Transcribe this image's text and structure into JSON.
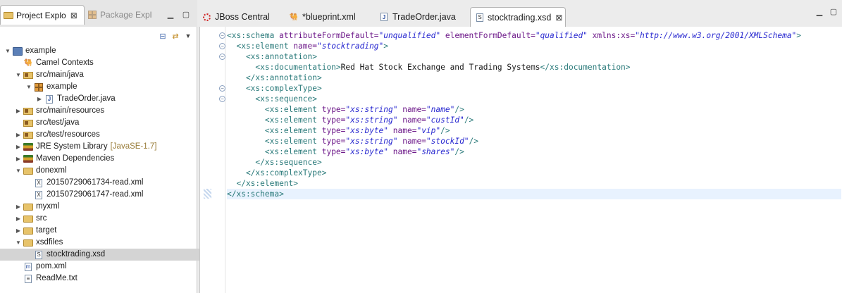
{
  "left_panel": {
    "tabs": [
      {
        "label": "Project Explo",
        "active": true,
        "close": "⊠"
      },
      {
        "label": "Package Expl",
        "active": false
      }
    ],
    "tree": [
      {
        "label": "example",
        "depth": 0,
        "arrow": "▼",
        "icon": "project-icon"
      },
      {
        "label": "Camel Contexts",
        "depth": 1,
        "arrow": "",
        "icon": "camel-icon"
      },
      {
        "label": "src/main/java",
        "depth": 1,
        "arrow": "▼",
        "icon": "source-folder-icon"
      },
      {
        "label": "example",
        "depth": 2,
        "arrow": "▼",
        "icon": "package-icon"
      },
      {
        "label": "TradeOrder.java",
        "depth": 3,
        "arrow": "▶",
        "icon": "java-file-icon"
      },
      {
        "label": "src/main/resources",
        "depth": 1,
        "arrow": "▶",
        "icon": "source-folder-icon"
      },
      {
        "label": "src/test/java",
        "depth": 1,
        "arrow": "",
        "icon": "source-folder-icon"
      },
      {
        "label": "src/test/resources",
        "depth": 1,
        "arrow": "▶",
        "icon": "source-folder-icon"
      },
      {
        "label": "JRE System Library",
        "suffix": "[JavaSE-1.7]",
        "depth": 1,
        "arrow": "▶",
        "icon": "library-icon"
      },
      {
        "label": "Maven Dependencies",
        "depth": 1,
        "arrow": "▶",
        "icon": "library-icon"
      },
      {
        "label": "donexml",
        "depth": 1,
        "arrow": "▼",
        "icon": "folder-icon"
      },
      {
        "label": "20150729061734-read.xml",
        "depth": 2,
        "arrow": "",
        "icon": "xml-file-icon"
      },
      {
        "label": "20150729061747-read.xml",
        "depth": 2,
        "arrow": "",
        "icon": "xml-file-icon"
      },
      {
        "label": "myxml",
        "depth": 1,
        "arrow": "▶",
        "icon": "folder-icon"
      },
      {
        "label": "src",
        "depth": 1,
        "arrow": "▶",
        "icon": "folder-icon"
      },
      {
        "label": "target",
        "depth": 1,
        "arrow": "▶",
        "icon": "folder-icon"
      },
      {
        "label": "xsdfiles",
        "depth": 1,
        "arrow": "▼",
        "icon": "folder-icon"
      },
      {
        "label": "stocktrading.xsd",
        "depth": 2,
        "arrow": "",
        "icon": "xsd-file-icon",
        "selected": true
      },
      {
        "label": "pom.xml",
        "depth": 1,
        "arrow": "",
        "icon": "maven-pom-icon"
      },
      {
        "label": "ReadMe.txt",
        "depth": 1,
        "arrow": "",
        "icon": "text-file-icon"
      }
    ]
  },
  "editor": {
    "tabs": [
      {
        "label": "JBoss Central",
        "icon": "jboss-icon"
      },
      {
        "label": "*blueprint.xml",
        "icon": "camel-icon"
      },
      {
        "label": "TradeOrder.java",
        "icon": "java-file-icon"
      },
      {
        "label": "stocktrading.xsd",
        "icon": "xsd-file-icon",
        "active": true,
        "close": "⊠"
      }
    ],
    "lines": [
      [
        [
          "tg",
          "<xs:schema "
        ],
        [
          "at",
          "attributeFormDefault="
        ],
        [
          "av",
          "\"unqualified\""
        ],
        [
          "at",
          " elementFormDefault="
        ],
        [
          "av",
          "\"qualified\""
        ],
        [
          "at",
          " xmlns:xs="
        ],
        [
          "av",
          "\"http://www.w3.org/2001/XMLSchema\""
        ],
        [
          "tg",
          ">"
        ]
      ],
      [
        [
          "tg",
          "  <xs:element "
        ],
        [
          "at",
          "name="
        ],
        [
          "av",
          "\"stocktrading\""
        ],
        [
          "tg",
          ">"
        ]
      ],
      [
        [
          "tg",
          "    <xs:annotation>"
        ]
      ],
      [
        [
          "tg",
          "      <xs:documentation>"
        ],
        [
          "tx",
          "Red Hat Stock Exchange and Trading Systems"
        ],
        [
          "tg",
          "</xs:documentation>"
        ]
      ],
      [
        [
          "tg",
          "    </xs:annotation>"
        ]
      ],
      [
        [
          "tg",
          "    <xs:complexType>"
        ]
      ],
      [
        [
          "tg",
          "      <xs:sequence>"
        ]
      ],
      [
        [
          "tg",
          "        <xs:element "
        ],
        [
          "at",
          "type="
        ],
        [
          "av",
          "\"xs:string\""
        ],
        [
          "at",
          " name="
        ],
        [
          "av",
          "\"name\""
        ],
        [
          "tg",
          "/>"
        ]
      ],
      [
        [
          "tg",
          "        <xs:element "
        ],
        [
          "at",
          "type="
        ],
        [
          "av",
          "\"xs:string\""
        ],
        [
          "at",
          " name="
        ],
        [
          "av",
          "\"custId\""
        ],
        [
          "tg",
          "/>"
        ]
      ],
      [
        [
          "tg",
          "        <xs:element "
        ],
        [
          "at",
          "type="
        ],
        [
          "av",
          "\"xs:byte\""
        ],
        [
          "at",
          " name="
        ],
        [
          "av",
          "\"vip\""
        ],
        [
          "tg",
          "/>"
        ]
      ],
      [
        [
          "tg",
          "        <xs:element "
        ],
        [
          "at",
          "type="
        ],
        [
          "av",
          "\"xs:string\""
        ],
        [
          "at",
          " name="
        ],
        [
          "av",
          "\"stockId\""
        ],
        [
          "tg",
          "/>"
        ]
      ],
      [
        [
          "tg",
          "        <xs:element "
        ],
        [
          "at",
          "type="
        ],
        [
          "av",
          "\"xs:byte\""
        ],
        [
          "at",
          " name="
        ],
        [
          "av",
          "\"shares\""
        ],
        [
          "tg",
          "/>"
        ]
      ],
      [
        [
          "tg",
          "      </xs:sequence>"
        ]
      ],
      [
        [
          "tg",
          "    </xs:complexType>"
        ]
      ],
      [
        [
          "tg",
          "  </xs:element>"
        ]
      ],
      [
        [
          "tg",
          "</xs:schema>"
        ]
      ]
    ],
    "fold_symbol": "−"
  }
}
